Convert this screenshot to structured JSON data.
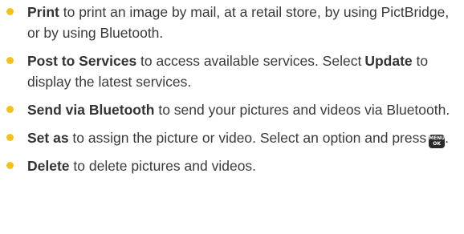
{
  "items": [
    {
      "term": "Print",
      "text": " to print an image by mail, at a retail store, by using PictBridge, or by using Bluetooth."
    },
    {
      "term": "Post to Services",
      "text": " to access available services. Select",
      "term2": "Update",
      "text2": " to display the latest services."
    },
    {
      "term": "Send via Bluetooth",
      "text": " to send your pictures and videos via Bluetooth."
    },
    {
      "term": "Set as",
      "text": " to assign the picture or video. Select an option and press",
      "key": {
        "top": "MENU",
        "bottom": "OK",
        "icon": "menu-ok-key-icon"
      },
      "text_end": "."
    },
    {
      "term": "Delete",
      "text": " to delete pictures and videos."
    }
  ],
  "colors": {
    "bullet": "#f2c318",
    "text": "#3a3a3a",
    "key_background": "#2a2a2a"
  }
}
